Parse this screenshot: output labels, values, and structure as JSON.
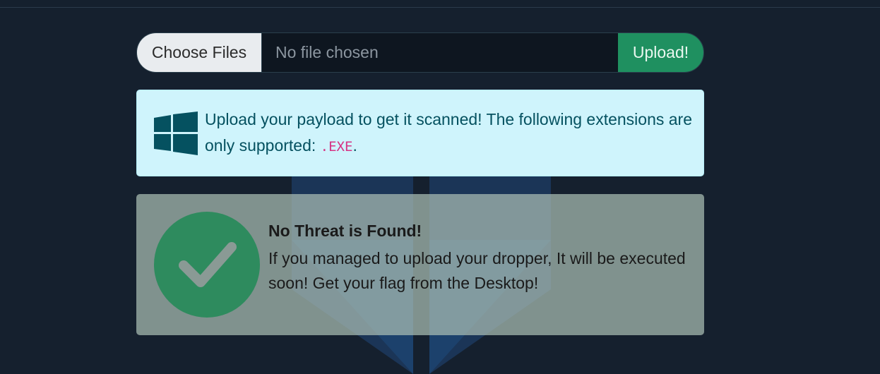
{
  "upload": {
    "choose_label": "Choose Files",
    "file_status": "No file chosen",
    "upload_label": "Upload!"
  },
  "info": {
    "text_before": "Upload your payload to get it scanned! The following extensions are only supported: ",
    "extension": ".EXE",
    "text_after": ".",
    "icon": "windows-logo-icon"
  },
  "result": {
    "title": "No Threat is Found!",
    "message": "If you managed to upload your dropper, It will be executed soon! Get your flag from the Desktop!",
    "icon": "checkmark-circle-icon"
  },
  "colors": {
    "background": "#15202e",
    "upload_button": "#1f9060",
    "info_bg": "#cff4fc",
    "info_text": "#055160",
    "code": "#d63384",
    "check_circle": "#2e8b5e"
  }
}
